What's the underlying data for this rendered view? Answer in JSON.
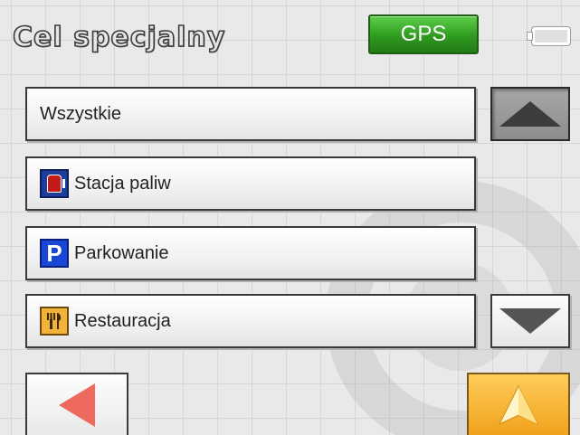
{
  "header": {
    "title": "Cel specjalny",
    "gps_label": "GPS"
  },
  "list": {
    "items": [
      {
        "label": "Wszystkie",
        "icon": null
      },
      {
        "label": "Stacja paliw",
        "icon": "fuel-station-icon"
      },
      {
        "label": "Parkowanie",
        "icon": "parking-icon"
      },
      {
        "label": "Restauracja",
        "icon": "restaurant-icon"
      }
    ]
  },
  "icons": {
    "parking_glyph": "P",
    "restaurant_glyph": "🍴"
  },
  "colors": {
    "gps_green": "#2f9a1f",
    "fuel_blue": "#1c3e9a",
    "parking_blue": "#1a46d6",
    "restaurant_orange": "#f3b33a",
    "back_arrow_red": "#ef6a5e",
    "navigate_orange": "#f0a21c"
  }
}
